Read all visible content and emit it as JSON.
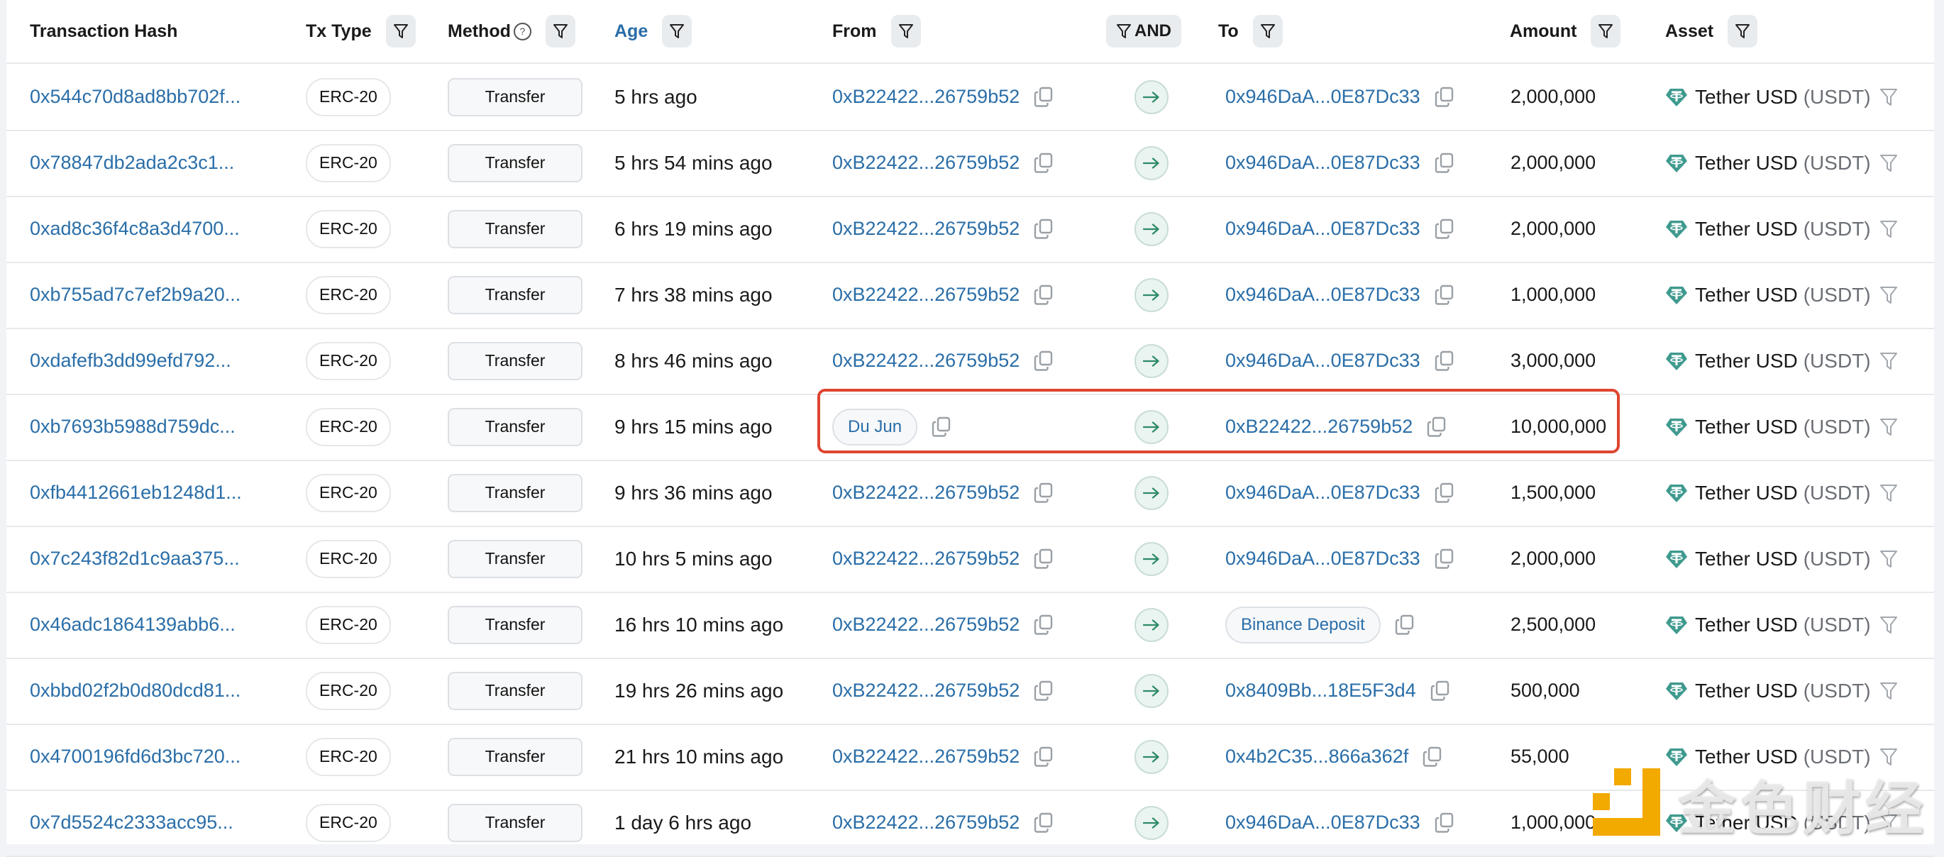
{
  "header": {
    "transaction_hash": "Transaction Hash",
    "tx_type": "Tx Type",
    "method": "Method",
    "method_help": "?",
    "age": "Age",
    "from": "From",
    "and_filter": "AND",
    "to": "To",
    "amount": "Amount",
    "asset": "Asset"
  },
  "colors": {
    "link": "#2a6ea8",
    "highlight_border": "#de4530",
    "arrow": "#2e8a67",
    "usdt": "#3f9a8e",
    "watermark_logo": "#f2a900"
  },
  "rows": [
    {
      "hash": "0x544c70d8ad8bb702f...",
      "tx_type": "ERC-20",
      "method": "Transfer",
      "age": "5 hrs ago",
      "from": "0xB22422...26759b52",
      "from_is_tag": false,
      "to": "0x946DaA...0E87Dc33",
      "to_is_tag": false,
      "amount": "2,000,000",
      "asset_name": "Tether USD",
      "asset_symbol": "(USDT)"
    },
    {
      "hash": "0x78847db2ada2c3c1...",
      "tx_type": "ERC-20",
      "method": "Transfer",
      "age": "5 hrs 54 mins ago",
      "from": "0xB22422...26759b52",
      "from_is_tag": false,
      "to": "0x946DaA...0E87Dc33",
      "to_is_tag": false,
      "amount": "2,000,000",
      "asset_name": "Tether USD",
      "asset_symbol": "(USDT)"
    },
    {
      "hash": "0xad8c36f4c8a3d4700...",
      "tx_type": "ERC-20",
      "method": "Transfer",
      "age": "6 hrs 19 mins ago",
      "from": "0xB22422...26759b52",
      "from_is_tag": false,
      "to": "0x946DaA...0E87Dc33",
      "to_is_tag": false,
      "amount": "2,000,000",
      "asset_name": "Tether USD",
      "asset_symbol": "(USDT)"
    },
    {
      "hash": "0xb755ad7c7ef2b9a20...",
      "tx_type": "ERC-20",
      "method": "Transfer",
      "age": "7 hrs 38 mins ago",
      "from": "0xB22422...26759b52",
      "from_is_tag": false,
      "to": "0x946DaA...0E87Dc33",
      "to_is_tag": false,
      "amount": "1,000,000",
      "asset_name": "Tether USD",
      "asset_symbol": "(USDT)"
    },
    {
      "hash": "0xdafefb3dd99efd792...",
      "tx_type": "ERC-20",
      "method": "Transfer",
      "age": "8 hrs 46 mins ago",
      "from": "0xB22422...26759b52",
      "from_is_tag": false,
      "to": "0x946DaA...0E87Dc33",
      "to_is_tag": false,
      "amount": "3,000,000",
      "asset_name": "Tether USD",
      "asset_symbol": "(USDT)"
    },
    {
      "hash": "0xb7693b5988d759dc...",
      "tx_type": "ERC-20",
      "method": "Transfer",
      "age": "9 hrs 15 mins ago",
      "from": "Du Jun",
      "from_is_tag": true,
      "to": "0xB22422...26759b52",
      "to_is_tag": false,
      "amount": "10,000,000",
      "asset_name": "Tether USD",
      "asset_symbol": "(USDT)",
      "highlighted": true
    },
    {
      "hash": "0xfb4412661eb1248d1...",
      "tx_type": "ERC-20",
      "method": "Transfer",
      "age": "9 hrs 36 mins ago",
      "from": "0xB22422...26759b52",
      "from_is_tag": false,
      "to": "0x946DaA...0E87Dc33",
      "to_is_tag": false,
      "amount": "1,500,000",
      "asset_name": "Tether USD",
      "asset_symbol": "(USDT)"
    },
    {
      "hash": "0x7c243f82d1c9aa375...",
      "tx_type": "ERC-20",
      "method": "Transfer",
      "age": "10 hrs 5 mins ago",
      "from": "0xB22422...26759b52",
      "from_is_tag": false,
      "to": "0x946DaA...0E87Dc33",
      "to_is_tag": false,
      "amount": "2,000,000",
      "asset_name": "Tether USD",
      "asset_symbol": "(USDT)"
    },
    {
      "hash": "0x46adc1864139abb6...",
      "tx_type": "ERC-20",
      "method": "Transfer",
      "age": "16 hrs 10 mins ago",
      "from": "0xB22422...26759b52",
      "from_is_tag": false,
      "to": "Binance Deposit",
      "to_is_tag": true,
      "amount": "2,500,000",
      "asset_name": "Tether USD",
      "asset_symbol": "(USDT)"
    },
    {
      "hash": "0xbbd02f2b0d80dcd81...",
      "tx_type": "ERC-20",
      "method": "Transfer",
      "age": "19 hrs 26 mins ago",
      "from": "0xB22422...26759b52",
      "from_is_tag": false,
      "to": "0x8409Bb...18E5F3d4",
      "to_is_tag": false,
      "amount": "500,000",
      "asset_name": "Tether USD",
      "asset_symbol": "(USDT)"
    },
    {
      "hash": "0x4700196fd6d3bc720...",
      "tx_type": "ERC-20",
      "method": "Transfer",
      "age": "21 hrs 10 mins ago",
      "from": "0xB22422...26759b52",
      "from_is_tag": false,
      "to": "0x4b2C35...866a362f",
      "to_is_tag": false,
      "amount": "55,000",
      "asset_name": "Tether USD",
      "asset_symbol": "(USDT)"
    },
    {
      "hash": "0x7d5524c2333acc95...",
      "tx_type": "ERC-20",
      "method": "Transfer",
      "age": "1 day 6 hrs ago",
      "from": "0xB22422...26759b52",
      "from_is_tag": false,
      "to": "0x946DaA...0E87Dc33",
      "to_is_tag": false,
      "amount": "1,000,000",
      "asset_name": "Tether USD",
      "asset_symbol": "(USDT)"
    }
  ],
  "watermark": {
    "text": "金色财经"
  }
}
